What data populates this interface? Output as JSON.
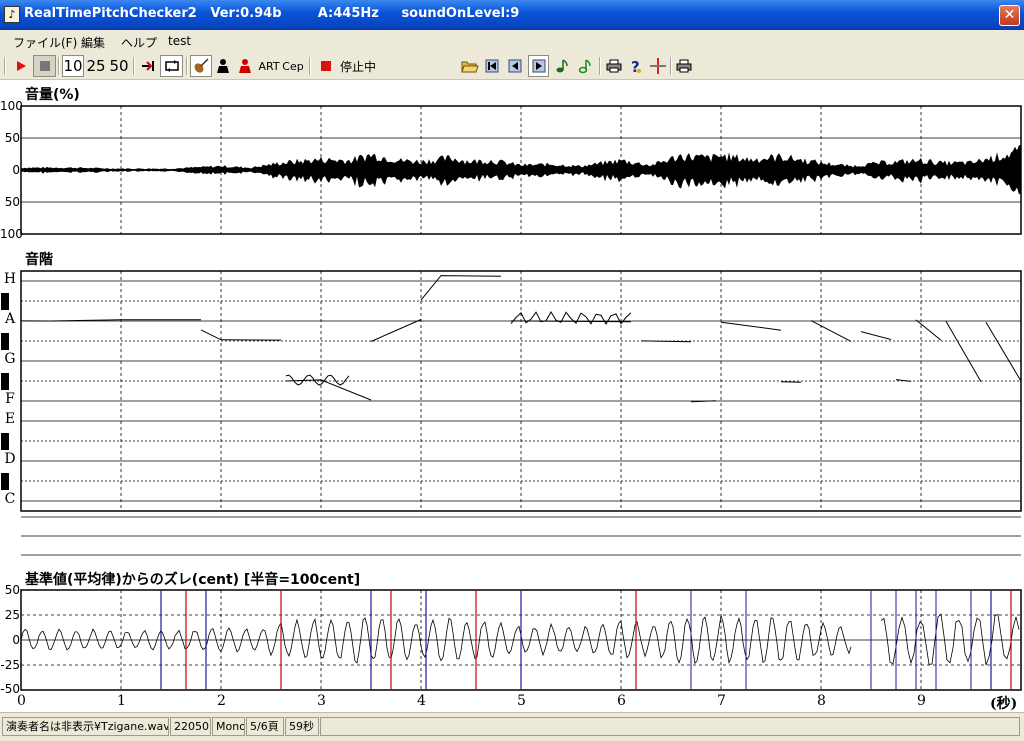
{
  "window": {
    "title": "RealTimePitchChecker2   Ver:0.94b        A:445Hz     soundOnLevel:9",
    "icon": "music-note-icon",
    "close_icon": "close-icon"
  },
  "menu": [
    "ファイル(F)",
    "編集",
    "ヘルプ",
    "test"
  ],
  "toolbar": {
    "play": "play-icon",
    "stop": "stop-icon",
    "zoom_options": [
      "10",
      "25",
      "50"
    ],
    "jump_end": "jump-end-icon",
    "loop": "loop-icon",
    "violin": "violin-icon",
    "person_dark": "person-icon",
    "person_red": "person-red-icon",
    "art_label": "ART",
    "cep_label": "Cep",
    "record_indicator": "record-icon",
    "state_label": "停止中",
    "status_display": "＊＊＊",
    "open_folder": "open-folder-icon",
    "skip_start": "skip-start-icon",
    "step_back": "step-back-icon",
    "step_forward": "step-forward-icon",
    "note_dark": "note-icon",
    "note_green": "note-green-icon",
    "print": "printer-icon",
    "help": "help-icon",
    "cross": "crosshair-icon",
    "print2": "printer-icon"
  },
  "volume_panel": {
    "title": "音量(%)",
    "y_labels": [
      "100",
      "50",
      "0",
      "50",
      "100"
    ]
  },
  "pitch_panel": {
    "title": "音階",
    "notes": [
      "H",
      "A",
      "G",
      "F",
      "E",
      "D",
      "C"
    ]
  },
  "deviation_panel": {
    "title": "基準値(平均律)からのズレ(cent) [半音=100cent]",
    "y_labels": [
      "50",
      "25",
      "0",
      "-25",
      "-50"
    ]
  },
  "x_axis": {
    "labels": [
      "0",
      "1",
      "2",
      "3",
      "4",
      "5",
      "6",
      "7",
      "8",
      "9"
    ],
    "unit_label": "(秒)"
  },
  "status_bar": {
    "file": "演奏者名は非表示¥Tzigane.wav",
    "rate": "22050",
    "channels": "Mono",
    "page": "5/6頁",
    "duration": "59秒"
  },
  "chart_data": {
    "type": "line",
    "xlabel": "(秒)",
    "xlim": [
      0,
      10
    ],
    "panels": [
      {
        "name": "音量(%)",
        "ylim": [
          -100,
          100
        ]
      },
      {
        "name": "音階",
        "categories": [
          "C",
          "D",
          "E",
          "F",
          "G",
          "A",
          "H"
        ]
      },
      {
        "name": "基準値(平均律)からのズレ(cent) [半音=100cent]",
        "ylim": [
          -50,
          50
        ]
      }
    ],
    "pitch_segments": [
      {
        "x": [
          0.0,
          0.3,
          1.0,
          1.8
        ],
        "y": [
          "A",
          "A",
          "A",
          "A"
        ]
      },
      {
        "x": [
          1.8,
          2.0,
          2.6
        ],
        "y": [
          "A-",
          "G+",
          "G+"
        ]
      },
      {
        "x": [
          2.65,
          3.0,
          3.5
        ],
        "y": [
          "F+",
          "F+",
          "F"
        ]
      },
      {
        "x": [
          3.5,
          4.0
        ],
        "y": [
          "G+",
          "A"
        ]
      },
      {
        "x": [
          4.0,
          4.2,
          4.8
        ],
        "y": [
          "A+",
          "H+",
          "H+"
        ]
      },
      {
        "x": [
          4.9,
          6.1
        ],
        "y": [
          "A",
          "A"
        ]
      },
      {
        "x": [
          6.2,
          6.7
        ],
        "y": [
          "G+",
          "G+"
        ]
      },
      {
        "x": [
          6.7,
          6.95
        ],
        "y": [
          "F",
          "F"
        ]
      },
      {
        "x": [
          7.0,
          7.6
        ],
        "y": [
          "A",
          "A-"
        ]
      },
      {
        "x": [
          7.6,
          7.8
        ],
        "y": [
          "F+",
          "F+"
        ]
      },
      {
        "x": [
          7.9,
          8.3
        ],
        "y": [
          "A",
          "G+"
        ]
      },
      {
        "x": [
          8.4,
          8.7
        ],
        "y": [
          "A-",
          "G+"
        ]
      },
      {
        "x": [
          8.75,
          8.9
        ],
        "y": [
          "F+",
          "F+"
        ]
      },
      {
        "x": [
          8.95,
          9.2
        ],
        "y": [
          "A",
          "G+"
        ]
      },
      {
        "x": [
          9.25,
          9.6
        ],
        "y": [
          "A",
          "F+"
        ]
      },
      {
        "x": [
          9.65,
          10.0
        ],
        "y": [
          "A",
          "F+"
        ]
      }
    ],
    "volume_envelope": {
      "x": [
        0,
        0.5,
        1.0,
        1.5,
        2.0,
        2.3,
        2.6,
        3.0,
        3.3,
        3.5,
        3.6,
        3.8,
        4.0,
        4.3,
        4.5,
        4.7,
        5.0,
        5.3,
        5.6,
        6.0,
        6.3,
        6.6,
        6.9,
        7.0,
        7.3,
        7.6,
        8.0,
        8.3,
        8.6,
        9.0,
        9.2,
        9.5,
        9.8,
        10.0
      ],
      "amplitude": [
        5,
        5,
        3,
        3,
        8,
        5,
        15,
        22,
        20,
        32,
        28,
        20,
        18,
        25,
        18,
        20,
        10,
        12,
        8,
        20,
        10,
        30,
        25,
        30,
        22,
        28,
        15,
        8,
        15,
        20,
        15,
        15,
        30,
        40
      ]
    }
  }
}
